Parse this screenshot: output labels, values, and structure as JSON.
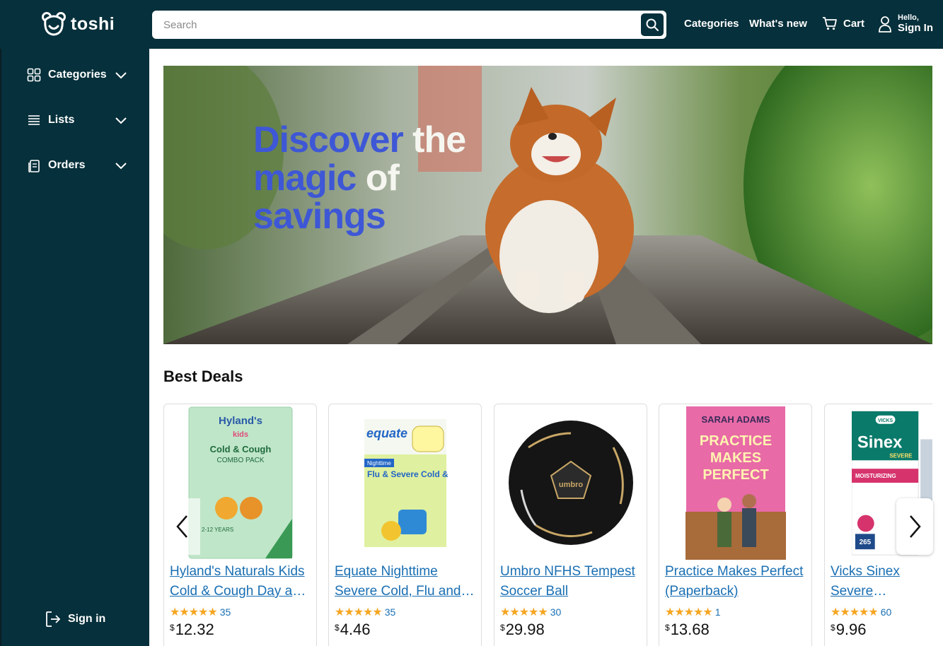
{
  "brand": {
    "name": "toshi"
  },
  "search": {
    "placeholder": "Search"
  },
  "header": {
    "categories_label": "Categories",
    "whats_new_label": "What's new",
    "cart_label": "Cart",
    "greeting": "Hello,",
    "signin_label": "Sign In"
  },
  "sidebar": {
    "items": [
      {
        "label": "Categories",
        "icon": "grid-icon"
      },
      {
        "label": "Lists",
        "icon": "list-icon"
      },
      {
        "label": "Orders",
        "icon": "orders-icon"
      }
    ],
    "signin_label": "Sign in"
  },
  "hero": {
    "line1_a": "Discover",
    "line1_b": " the",
    "line2_a": "magic",
    "line2_b": " of",
    "line3": "savings"
  },
  "deals": {
    "title": "Best Deals",
    "products": [
      {
        "title": "Hyland's Naturals Kids Cold & Cough Day and Night",
        "stars": "★★★★★",
        "reviews": "35",
        "currency": "$",
        "price": "12.32"
      },
      {
        "title": "Equate Nighttime Severe Cold, Flu and Cough",
        "stars": "★★★★★",
        "reviews": "35",
        "currency": "$",
        "price": "4.46"
      },
      {
        "title": "Umbro NFHS Tempest Soccer Ball",
        "stars": "★★★★★",
        "reviews": "30",
        "currency": "$",
        "price": "29.98"
      },
      {
        "title": "Practice Makes Perfect (Paperback)",
        "stars": "★★★★★",
        "reviews": "1",
        "currency": "$",
        "price": "13.68"
      },
      {
        "title": "Vicks Sinex Severe Moisturizing Ultra Fine Mist",
        "stars": "★★★★★",
        "reviews": "60",
        "currency": "$",
        "price": "9.96"
      }
    ],
    "product_images": {
      "hylands": {
        "brand": "Hyland's",
        "sub": "kids",
        "name": "Cold & Cough",
        "pack": "COMBO PACK",
        "age": "2-12 YEARS"
      },
      "equate": {
        "brand": "equate",
        "tag": "Nighttime",
        "name": "Flu & Severe Cold & Cough"
      },
      "umbro": {
        "brand": "umbro"
      },
      "book": {
        "author": "SARAH ADAMS",
        "line1": "PRACTICE",
        "line2": "MAKES",
        "line3": "PERFECT"
      },
      "vicks": {
        "logo": "VICKS",
        "brand": "Sinex",
        "tag": "SEVERE",
        "sub": "MOISTURIZING",
        "count": "265"
      }
    }
  },
  "colors": {
    "header_bg": "#06303b",
    "link": "#1a6fb3",
    "star": "#f5a623",
    "hero_blue": "#3e57d6"
  }
}
